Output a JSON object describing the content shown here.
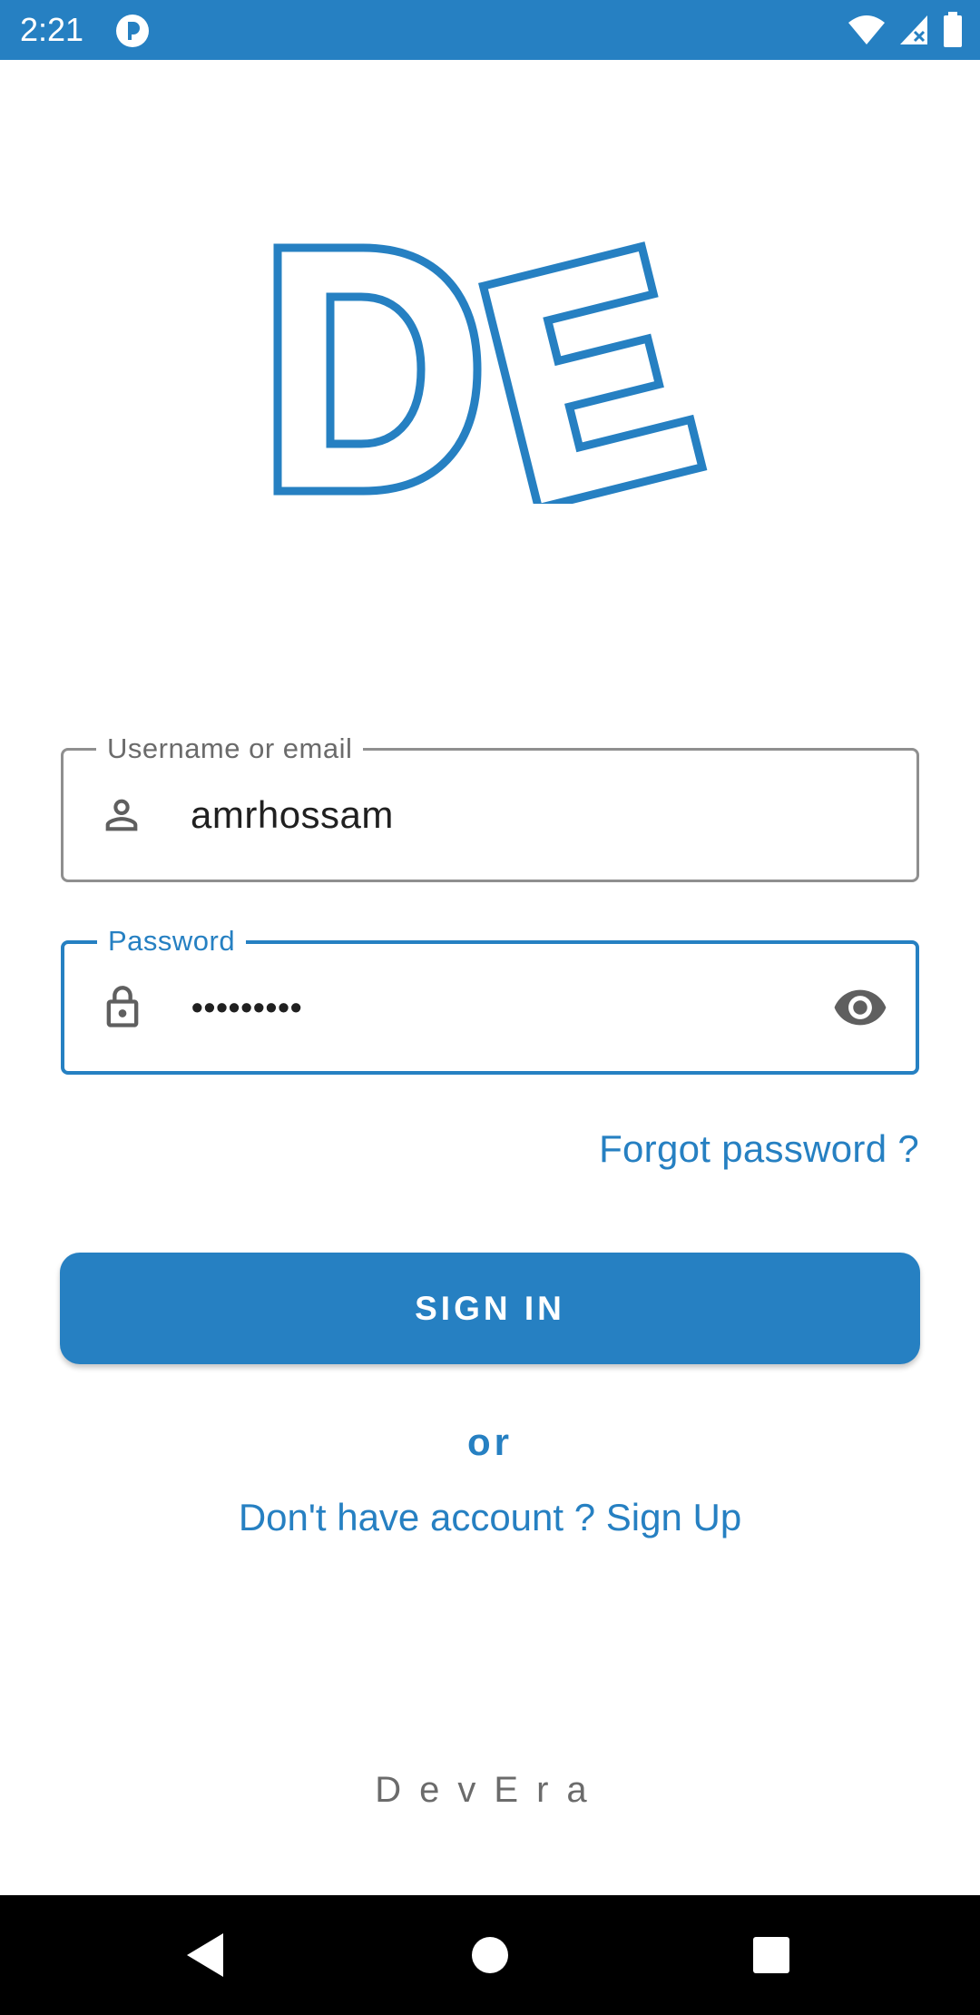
{
  "status_bar": {
    "time": "2:21",
    "icons": [
      "app-notification-icon",
      "wifi-icon",
      "signal-icon",
      "battery-icon"
    ]
  },
  "logo": {
    "icon": "devera-logo"
  },
  "username_field": {
    "label": "Username or email",
    "value": "amrhossam",
    "icon": "person-icon"
  },
  "password_field": {
    "label": "Password",
    "value": "•••••••••",
    "icon": "lock-icon",
    "toggle_icon": "eye-icon"
  },
  "forgot_password": "Forgot password ?",
  "sign_in": "SIGN IN",
  "or_text": "or",
  "sign_up": "Don't have account ? Sign Up",
  "brand": "DevEra",
  "nav": [
    "back",
    "home",
    "recents"
  ],
  "colors": {
    "accent": "#2680c2",
    "status_bar": "#2680c2",
    "nav_bar": "#000000"
  }
}
